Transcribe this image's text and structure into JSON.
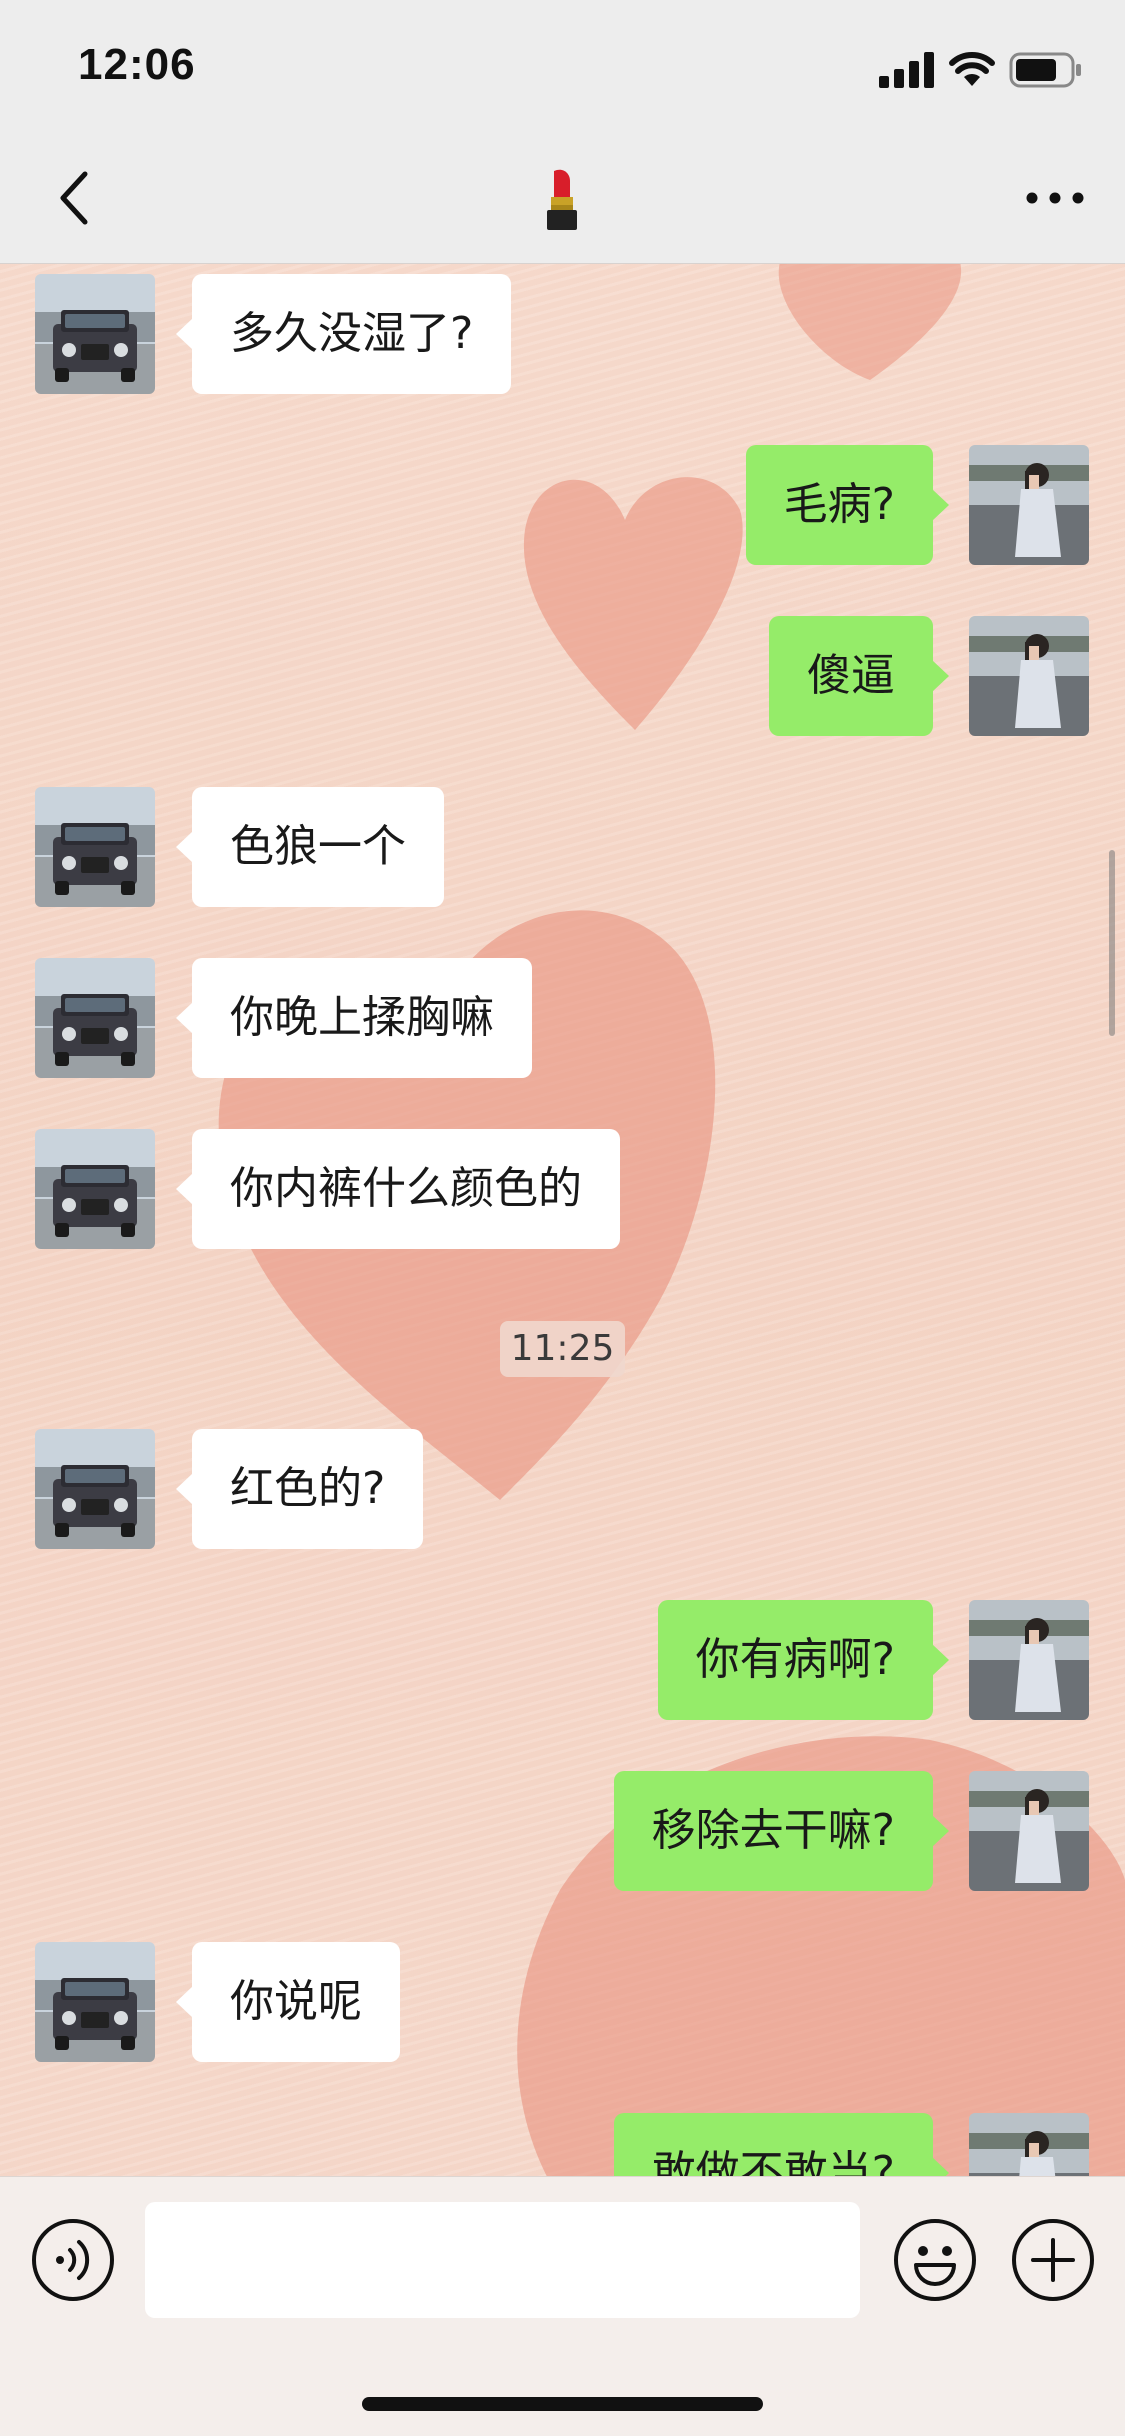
{
  "status_bar": {
    "time": "12:06",
    "icons": [
      "cellular-signal-icon",
      "wifi-icon",
      "battery-icon"
    ]
  },
  "nav": {
    "back_icon": "chevron-left-icon",
    "title_icon": "lipstick-icon",
    "more_icon": "more-dots-icon"
  },
  "messages": [
    {
      "side": "in",
      "text": "多久没湿了?"
    },
    {
      "side": "out",
      "text": "毛病?"
    },
    {
      "side": "out",
      "text": "傻逼"
    },
    {
      "side": "in",
      "text": "色狼一个"
    },
    {
      "side": "in",
      "text": "你晚上揉胸嘛"
    },
    {
      "side": "in",
      "text": "你内裤什么颜色的"
    },
    {
      "side": "in",
      "text": "红色的?"
    },
    {
      "side": "out",
      "text": "你有病啊?"
    },
    {
      "side": "out",
      "text": "移除去干嘛?"
    },
    {
      "side": "in",
      "text": "你说呢"
    },
    {
      "side": "out",
      "text": "敢做不敢当?"
    }
  ],
  "timestamp": "11:25",
  "input_bar": {
    "voice_icon": "voice-icon",
    "input_value": "",
    "emoji_icon": "emoji-icon",
    "plus_icon": "plus-icon"
  },
  "colors": {
    "incoming_bubble": "#ffffff",
    "outgoing_bubble": "#95ec69",
    "header_background": "#ededed",
    "wallpaper": "#f6d8cb",
    "heart": "#e9937f"
  }
}
